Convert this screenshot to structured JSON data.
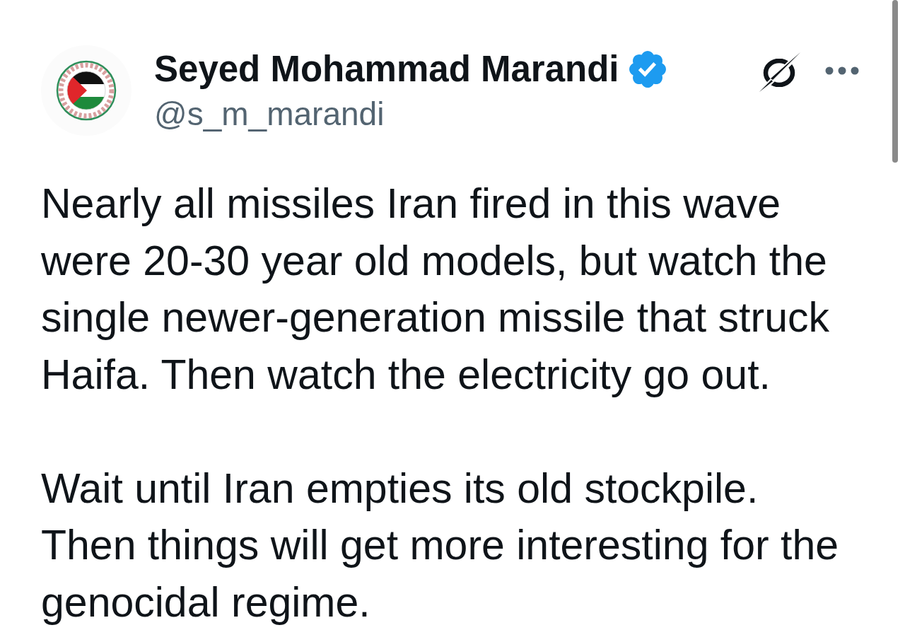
{
  "post": {
    "author": {
      "name": "Seyed Mohammad Marandi",
      "verified": true,
      "handle": "@s_m_marandi"
    },
    "paragraphs": [
      "Nearly all missiles Iran fired in this wave were 20-30 year old models, but watch the single newer-generation missile that struck Haifa. Then watch the electricity go out.",
      "Wait until Iran empties its old stockpile. Then things will get more interesting for the genocidal regime."
    ]
  }
}
